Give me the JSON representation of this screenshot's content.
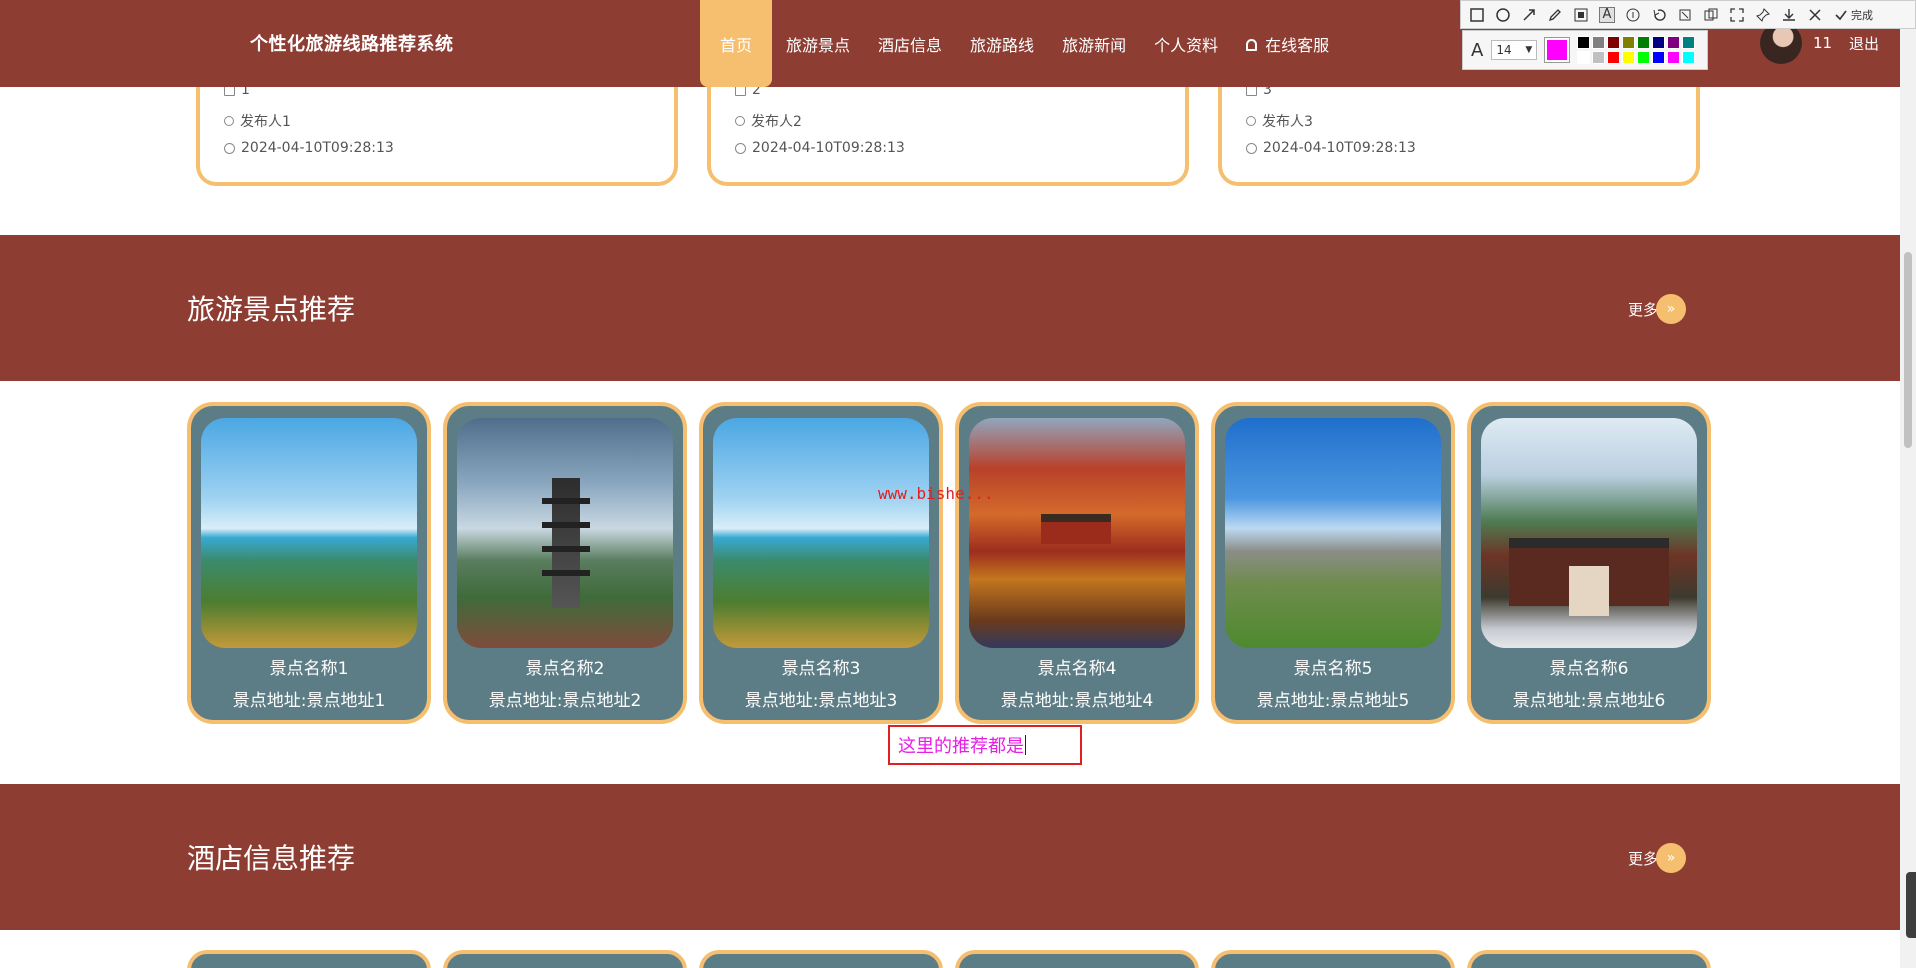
{
  "header": {
    "site_title": "个性化旅游线路推荐系统",
    "nav": [
      {
        "label": "首页",
        "active": true
      },
      {
        "label": "旅游景点"
      },
      {
        "label": "酒店信息"
      },
      {
        "label": "旅游路线"
      },
      {
        "label": "旅游新闻"
      },
      {
        "label": "个人资料"
      },
      {
        "label": "在线客服",
        "icon": "bell-icon"
      }
    ],
    "user_name": "11",
    "logout": "退出"
  },
  "annotation_toolbar": {
    "tools": [
      "rectangle-icon",
      "ellipse-icon",
      "arrow-icon",
      "pencil-icon",
      "mosaic-icon",
      "text-icon",
      "number-icon",
      "undo-icon",
      "pin-icon",
      "copy-icon",
      "fullscreen-icon",
      "pin2-icon",
      "download-icon",
      "close-icon"
    ],
    "done_label": "完成",
    "font_size": "14",
    "current_color": "#ff00ff",
    "palette": [
      "#000000",
      "#808080",
      "#800000",
      "#808000",
      "#008000",
      "#000080",
      "#800080",
      "#008080",
      "#ffffff",
      "#c0c0c0",
      "#ff0000",
      "#ffff00",
      "#00ff00",
      "#0000ff",
      "#ff00ff",
      "#00ffff"
    ]
  },
  "news_cards": [
    {
      "id": "1",
      "publisher": "发布人1",
      "time": "2024-04-10T09:28:13"
    },
    {
      "id": "2",
      "publisher": "发布人2",
      "time": "2024-04-10T09:28:13"
    },
    {
      "id": "3",
      "publisher": "发布人3",
      "time": "2024-04-10T09:28:13"
    }
  ],
  "sections": {
    "scenic": {
      "title": "旅游景点推荐",
      "more": "更多"
    },
    "hotel": {
      "title": "酒店信息推荐",
      "more": "更多"
    }
  },
  "scenic_cards": [
    {
      "name": "景点名称1",
      "address": "景点地址:景点地址1",
      "image": "mountain-sea-of-clouds"
    },
    {
      "name": "景点名称2",
      "address": "景点地址:景点地址2",
      "image": "pagoda"
    },
    {
      "name": "景点名称3",
      "address": "景点地址:景点地址3",
      "image": "mountain-sea-of-clouds"
    },
    {
      "name": "景点名称4",
      "address": "景点地址:景点地址4",
      "image": "autumn-pavilion"
    },
    {
      "name": "景点名称5",
      "address": "景点地址:景点地址5",
      "image": "stone-forest"
    },
    {
      "name": "景点名称6",
      "address": "景点地址:景点地址6",
      "image": "gate-building"
    }
  ],
  "watermark": "www.bishe...",
  "annotation_text": "这里的推荐都是"
}
